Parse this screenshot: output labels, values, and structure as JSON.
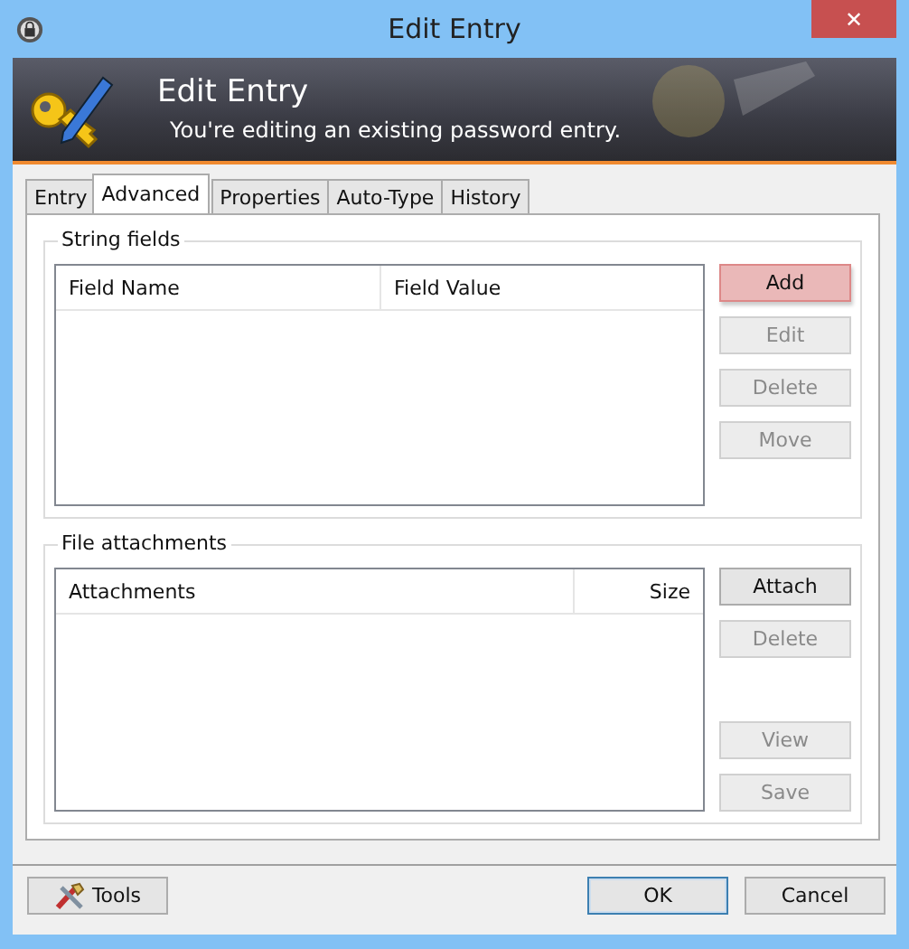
{
  "window": {
    "title": "Edit Entry",
    "close": "✕"
  },
  "banner": {
    "title": "Edit Entry",
    "subtitle": "You're editing an existing password entry."
  },
  "tabs": [
    {
      "label": "Entry",
      "selected": false
    },
    {
      "label": "Advanced",
      "selected": true
    },
    {
      "label": "Properties",
      "selected": false
    },
    {
      "label": "Auto-Type",
      "selected": false
    },
    {
      "label": "History",
      "selected": false
    }
  ],
  "groups": [
    {
      "title": "String fields",
      "columns": [
        {
          "label": "Field Name"
        },
        {
          "label": "Field Value"
        }
      ],
      "buttons": [
        {
          "label": "Add",
          "disabled": false,
          "hovered": true
        },
        {
          "label": "Edit",
          "disabled": true,
          "hovered": false
        },
        {
          "label": "Delete",
          "disabled": true,
          "hovered": false
        },
        {
          "label": "Move",
          "disabled": true,
          "hovered": false
        }
      ]
    },
    {
      "title": "File attachments",
      "columns": [
        {
          "label": "Attachments"
        },
        {
          "label": "Size"
        }
      ],
      "buttons": [
        {
          "label": "Attach",
          "disabled": false,
          "hovered": false
        },
        {
          "label": "Delete",
          "disabled": true,
          "hovered": false
        },
        {
          "label": "View",
          "disabled": true,
          "hovered": false
        },
        {
          "label": "Save",
          "disabled": true,
          "hovered": false
        }
      ]
    }
  ],
  "footer": {
    "buttons": [
      {
        "label": "Tools",
        "kind": "tools",
        "focused": false
      },
      {
        "label": "OK",
        "kind": "plain",
        "focused": true
      },
      {
        "label": "Cancel",
        "kind": "plain",
        "focused": false
      }
    ]
  }
}
